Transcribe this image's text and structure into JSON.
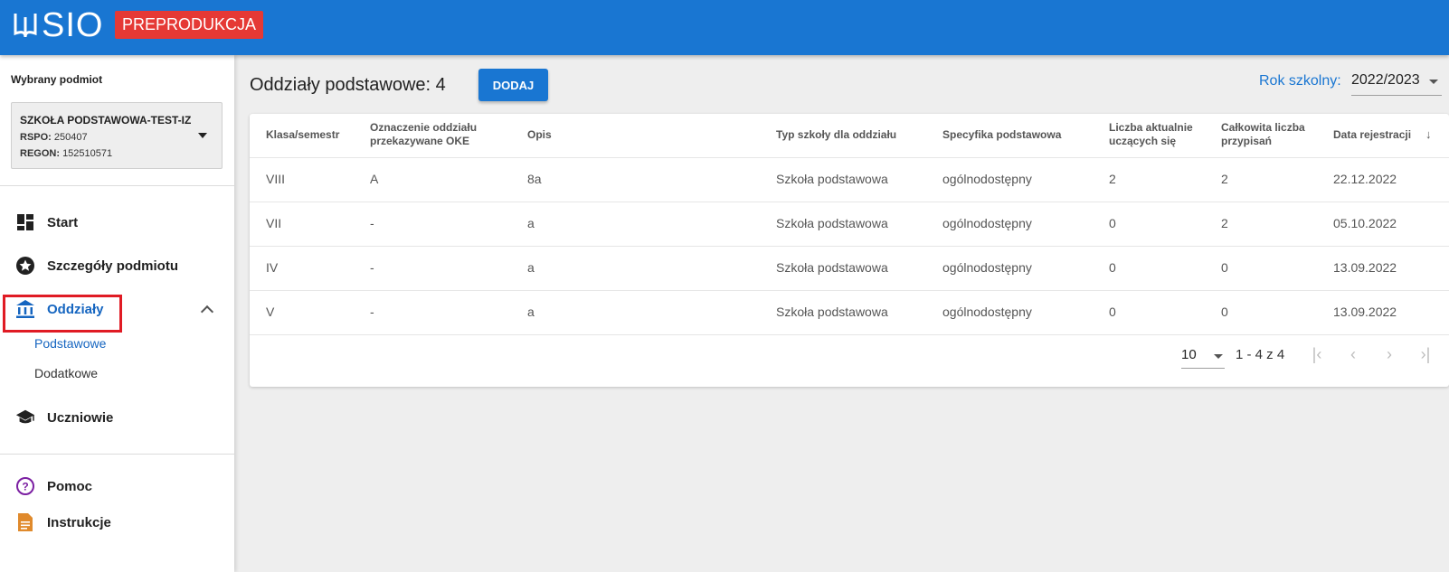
{
  "header": {
    "app_name": "SIO",
    "env_badge": "PREPRODUKCJA"
  },
  "sidebar": {
    "selected_label": "Wybrany podmiot",
    "entity": {
      "name": "SZKOŁA PODSTAWOWA-TEST-IZ",
      "rspo_label": "RSPO:",
      "rspo_value": "250407",
      "regon_label": "REGON:",
      "regon_value": "152510571"
    },
    "items": [
      {
        "label": "Start",
        "icon": "dashboard-icon"
      },
      {
        "label": "Szczegóły podmiotu",
        "icon": "star-icon"
      },
      {
        "label": "Oddziały",
        "icon": "bank-icon"
      },
      {
        "label": "Uczniowie",
        "icon": "school-icon"
      },
      {
        "label": "Pomoc",
        "icon": "help-icon"
      },
      {
        "label": "Instrukcje",
        "icon": "document-icon"
      }
    ],
    "subitems": [
      {
        "label": "Podstawowe"
      },
      {
        "label": "Dodatkowe"
      }
    ]
  },
  "main": {
    "title": "Oddziały podstawowe: 4",
    "add_label": "DODAJ",
    "year_label": "Rok szkolny:",
    "year_value": "2022/2023"
  },
  "table": {
    "columns": [
      {
        "line1": "Klasa/semestr",
        "line2": ""
      },
      {
        "line1": "Oznaczenie oddziału",
        "line2": "przekazywane OKE"
      },
      {
        "line1": "Opis",
        "line2": ""
      },
      {
        "line1": "Typ szkoły dla oddziału",
        "line2": ""
      },
      {
        "line1": "Specyfika podstawowa",
        "line2": ""
      },
      {
        "line1": "Liczba aktualnie",
        "line2": "uczących się"
      },
      {
        "line1": "Całkowita liczba",
        "line2": "przypisań"
      },
      {
        "line1": "Data rejestracji",
        "line2": ""
      }
    ],
    "rows": [
      [
        "VIII",
        "A",
        "8a",
        "Szkoła podstawowa",
        "ogólnodostępny",
        "2",
        "2",
        "22.12.2022"
      ],
      [
        "VII",
        "-",
        "a",
        "Szkoła podstawowa",
        "ogólnodostępny",
        "0",
        "2",
        "05.10.2022"
      ],
      [
        "IV",
        "-",
        "a",
        "Szkoła podstawowa",
        "ogólnodostępny",
        "0",
        "0",
        "13.09.2022"
      ],
      [
        "V",
        "-",
        "a",
        "Szkoła podstawowa",
        "ogólnodostępny",
        "0",
        "0",
        "13.09.2022"
      ]
    ],
    "sort_icon": "arrow-down-icon"
  },
  "pagination": {
    "page_size": "10",
    "range": "1 - 4 z 4"
  },
  "colors": {
    "primary": "#1976d2",
    "badge": "#e53935",
    "highlight": "#e01b24"
  }
}
